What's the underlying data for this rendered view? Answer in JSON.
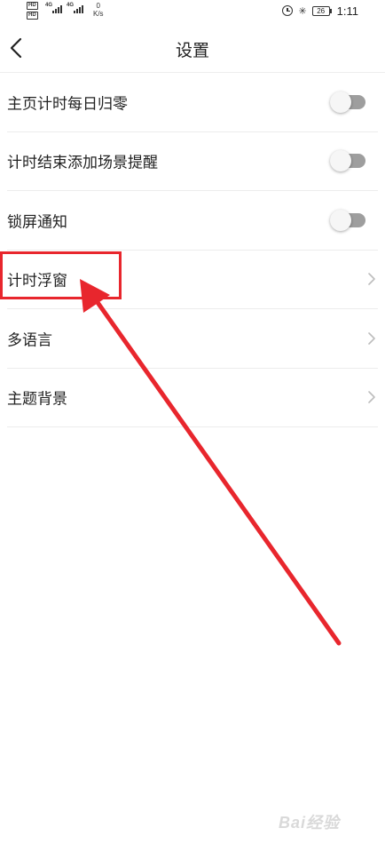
{
  "status_bar": {
    "left": {
      "sim1_hd": "HD",
      "sim2_hd": "HD",
      "sim1_network": "4G",
      "sim2_network": "4G",
      "speed_value": "0",
      "speed_unit": "K/s"
    },
    "right": {
      "battery_level": "26",
      "time": "1:11"
    }
  },
  "header": {
    "title": "设置",
    "back_icon": "chevron-left-icon"
  },
  "settings": {
    "items": [
      {
        "label": "主页计时每日归零",
        "control": "toggle",
        "enabled": false
      },
      {
        "label": "计时结束添加场景提醒",
        "control": "toggle",
        "enabled": false
      },
      {
        "label": "锁屏通知",
        "control": "toggle",
        "enabled": false
      },
      {
        "label": "计时浮窗",
        "control": "chevron"
      },
      {
        "label": "多语言",
        "control": "chevron"
      },
      {
        "label": "主题背景",
        "control": "chevron"
      }
    ]
  },
  "annotation": {
    "color": "#e8262d",
    "highlighted_item": "计时浮窗"
  },
  "colors": {
    "background": "#ffffff",
    "toggle_off_track": "#9e9e9e",
    "divider": "#ececec"
  }
}
